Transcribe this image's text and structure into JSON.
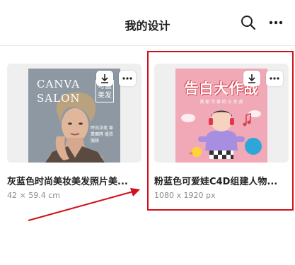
{
  "header": {
    "title": "我的设计",
    "icons": [
      "search-icon",
      "more-icon"
    ]
  },
  "designs": [
    {
      "name": "灰蓝色时尚美妆美发照片美...",
      "size": "42 × 59.4 cm",
      "poster": {
        "title_lines": [
          "CANVA",
          "SALON"
        ],
        "side_text": "可盈美发",
        "caption": "時尚洋美 專業團隊 優質服務"
      }
    },
    {
      "name": "粉蓝色可爱娃C4D组建人物...",
      "size": "1080 x 1920 px",
      "poster": {
        "title": "告白大作战",
        "subtitle": "美 丽 可 爱 的 小 女 孩"
      }
    }
  ],
  "card_actions": [
    "download-icon",
    "more-icon"
  ],
  "annotation": {
    "highlight_color": "#d0111b",
    "arrow_color": "#d0111b"
  }
}
